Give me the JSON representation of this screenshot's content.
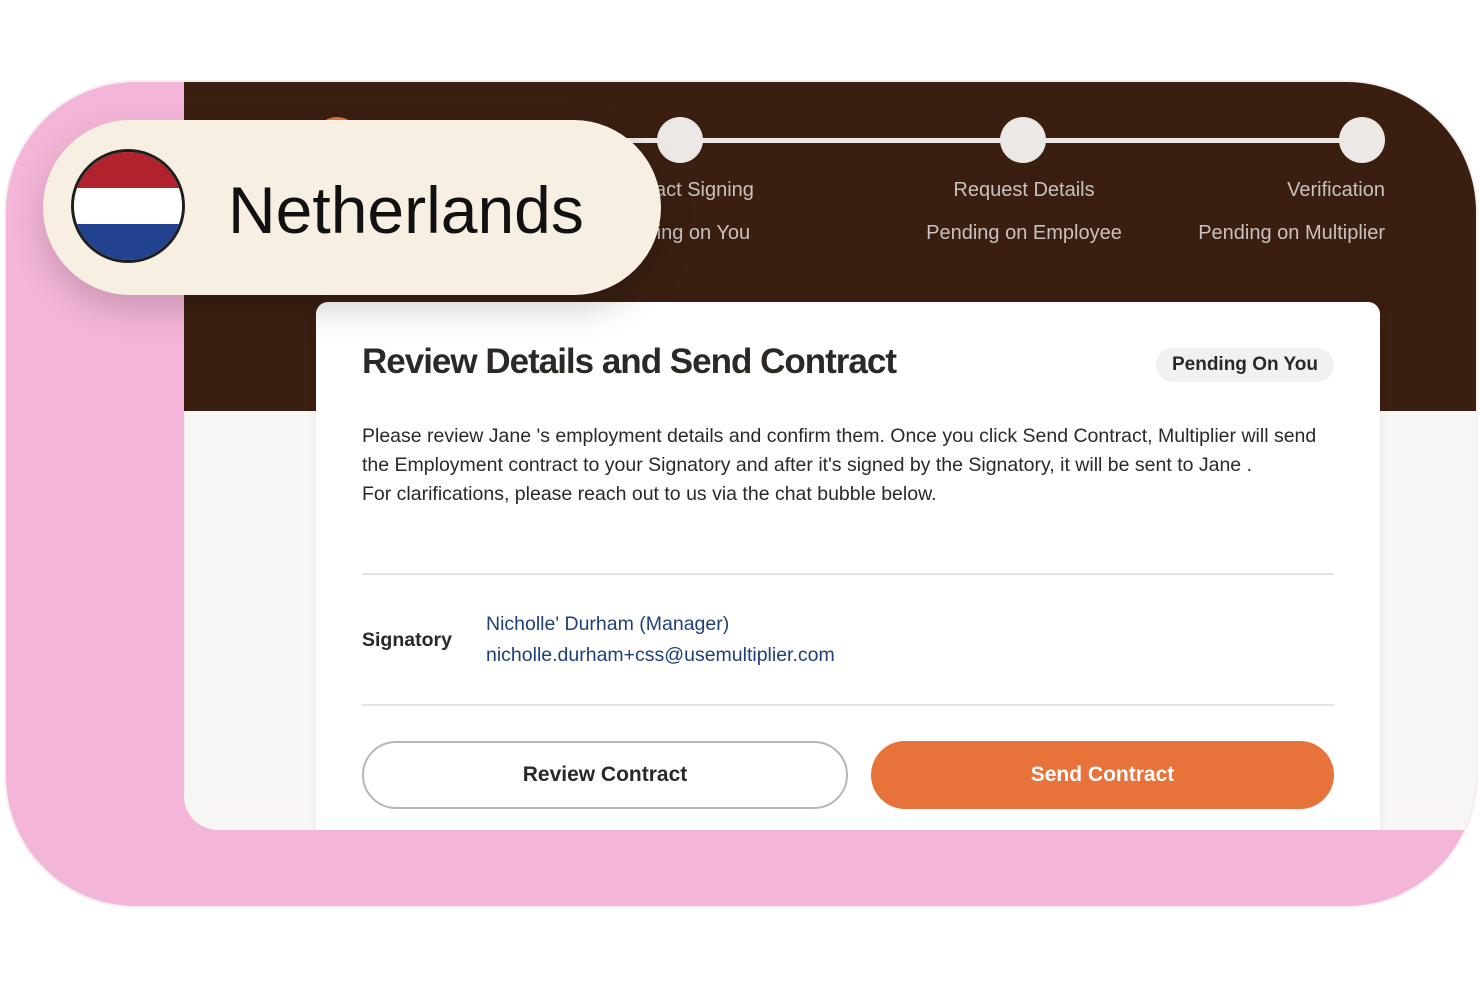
{
  "country": {
    "name": "Netherlands",
    "flag_icon": "netherlands-flag-icon",
    "flag_colors": [
      "#b1222e",
      "#ffffff",
      "#22418e"
    ]
  },
  "stepper": {
    "steps": [
      {
        "title": "Contract Signing",
        "status": "Pending on You"
      },
      {
        "title": "Request Details",
        "status": "Pending on Employee"
      },
      {
        "title": "Verification",
        "status": "Pending on Multiplier"
      }
    ]
  },
  "card": {
    "title": "Review Details and Send Contract",
    "badge": "Pending On You",
    "paragraph1": "Please review Jane 's employment details and confirm them. Once you click Send Contract, Multiplier will send the Employment contract to your Signatory and after it's signed by the Signatory, it will be sent to Jane .",
    "paragraph2": "For clarifications, please reach out to us via the chat bubble below.",
    "signatory": {
      "label": "Signatory",
      "name": "Nicholle' Durham (Manager)",
      "email": "nicholle.durham+css@usemultiplier.com"
    },
    "buttons": {
      "review": "Review Contract",
      "send": "Send Contract"
    }
  },
  "colors": {
    "background_pink": "#f4b6d8",
    "header_brown": "#3a1f11",
    "accent_orange": "#e8733a",
    "link_blue": "#1f3f7a"
  }
}
